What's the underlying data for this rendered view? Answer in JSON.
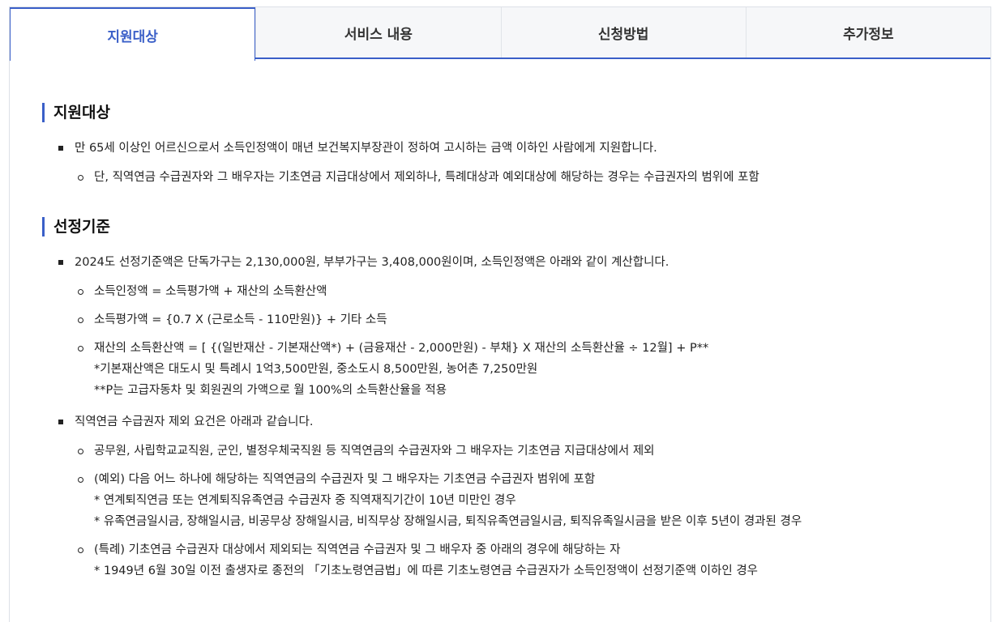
{
  "tabs": [
    "지원대상",
    "서비스 내용",
    "신청방법",
    "추가정보"
  ],
  "sections": {
    "s1": {
      "title": "지원대상",
      "item1": "만 65세 이상인 어르신으로서 소득인정액이 매년 보건복지부장관이 정하여 고시하는 금액 이하인 사람에게 지원합니다.",
      "item1_sub1": "단, 직역연금 수급권자와 그 배우자는 기초연금 지급대상에서 제외하나, 특례대상과 예외대상에 해당하는 경우는 수급권자의 범위에 포함"
    },
    "s2": {
      "title": "선정기준",
      "item1": "2024도 선정기준액은 단독가구는 2,130,000원, 부부가구는 3,408,000원이며, 소득인정액은 아래와 같이 계산합니다.",
      "item1_sub1": "소득인정액 = 소득평가액 + 재산의 소득환산액",
      "item1_sub2": "소득평가액 = {0.7 X (근로소득 - 110만원)} + 기타 소득",
      "item1_sub3": "재산의 소득환산액 = [ {(일반재산 - 기본재산액*) + (금융재산 - 2,000만원) - 부채} X 재산의 소득환산율 ÷ 12월] + P**",
      "item1_sub3_note1": "*기본재산액은 대도시 및 특례시 1억3,500만원, 중소도시 8,500만원, 농어촌 7,250만원",
      "item1_sub3_note2": "**P는 고급자동차 및 회원권의 가액으로 월 100%의 소득환산율을 적용",
      "item2": "직역연금 수급권자 제외 요건은 아래과 같습니다.",
      "item2_sub1": "공무원, 사립학교교직원, 군인, 별정우체국직원 등 직역연금의 수급권자와 그 배우자는 기초연금 지급대상에서 제외",
      "item2_sub2": "(예외) 다음 어느 하나에 해당하는 직역연금의 수급권자 및 그 배우자는 기초연금 수급권자 범위에 포함",
      "item2_sub2_note1": "* 연계퇴직연금 또는 연계퇴직유족연금 수급권자 중 직역재직기간이 10년 미만인 경우",
      "item2_sub2_note2": "* 유족연금일시금, 장해일시금, 비공무상 장해일시금, 비직무상 장해일시금, 퇴직유족연금일시금, 퇴직유족일시금을 받은 이후 5년이 경과된 경우",
      "item2_sub3": "(특례) 기초연금 수급권자 대상에서 제외되는 직역연금 수급권자 및 그 배우자 중 아래의 경우에 해당하는 자",
      "item2_sub3_note1": "* 1949년 6월 30일 이전 출생자로 종전의 「기초노령연금법」에 따른 기초노령연금 수급권자가 소득인정액이 선정기준액 이하인 경우"
    }
  }
}
